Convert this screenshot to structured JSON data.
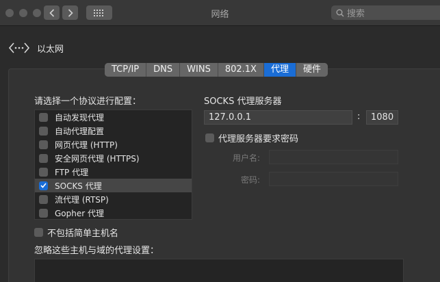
{
  "window": {
    "title": "网络"
  },
  "search": {
    "placeholder": "搜索"
  },
  "header": {
    "interface_name": "以太网"
  },
  "tabs": [
    {
      "label": "TCP/IP",
      "active": false
    },
    {
      "label": "DNS",
      "active": false
    },
    {
      "label": "WINS",
      "active": false
    },
    {
      "label": "802.1X",
      "active": false
    },
    {
      "label": "代理",
      "active": true
    },
    {
      "label": "硬件",
      "active": false
    }
  ],
  "protocols": {
    "heading": "请选择一个协议进行配置：",
    "items": [
      {
        "label": "自动发现代理",
        "checked": false,
        "selected": false
      },
      {
        "label": "自动代理配置",
        "checked": false,
        "selected": false
      },
      {
        "label": "网页代理 (HTTP)",
        "checked": false,
        "selected": false
      },
      {
        "label": "安全网页代理 (HTTPS)",
        "checked": false,
        "selected": false
      },
      {
        "label": "FTP 代理",
        "checked": false,
        "selected": false
      },
      {
        "label": "SOCKS 代理",
        "checked": true,
        "selected": true
      },
      {
        "label": "流代理 (RTSP)",
        "checked": false,
        "selected": false
      },
      {
        "label": "Gopher 代理",
        "checked": false,
        "selected": false
      }
    ]
  },
  "exclude_simple_hosts": {
    "label": "不包括简单主机名",
    "checked": false
  },
  "bypass": {
    "heading": "忽略这些主机与域的代理设置："
  },
  "socks": {
    "heading": "SOCKS 代理服务器",
    "server": "127.0.0.1",
    "separator": ":",
    "port": "1080",
    "auth_required": {
      "label": "代理服务器要求密码",
      "checked": false
    },
    "username_label": "用户名:",
    "password_label": "密码:"
  },
  "colors": {
    "accent": "#1a6dd6"
  }
}
